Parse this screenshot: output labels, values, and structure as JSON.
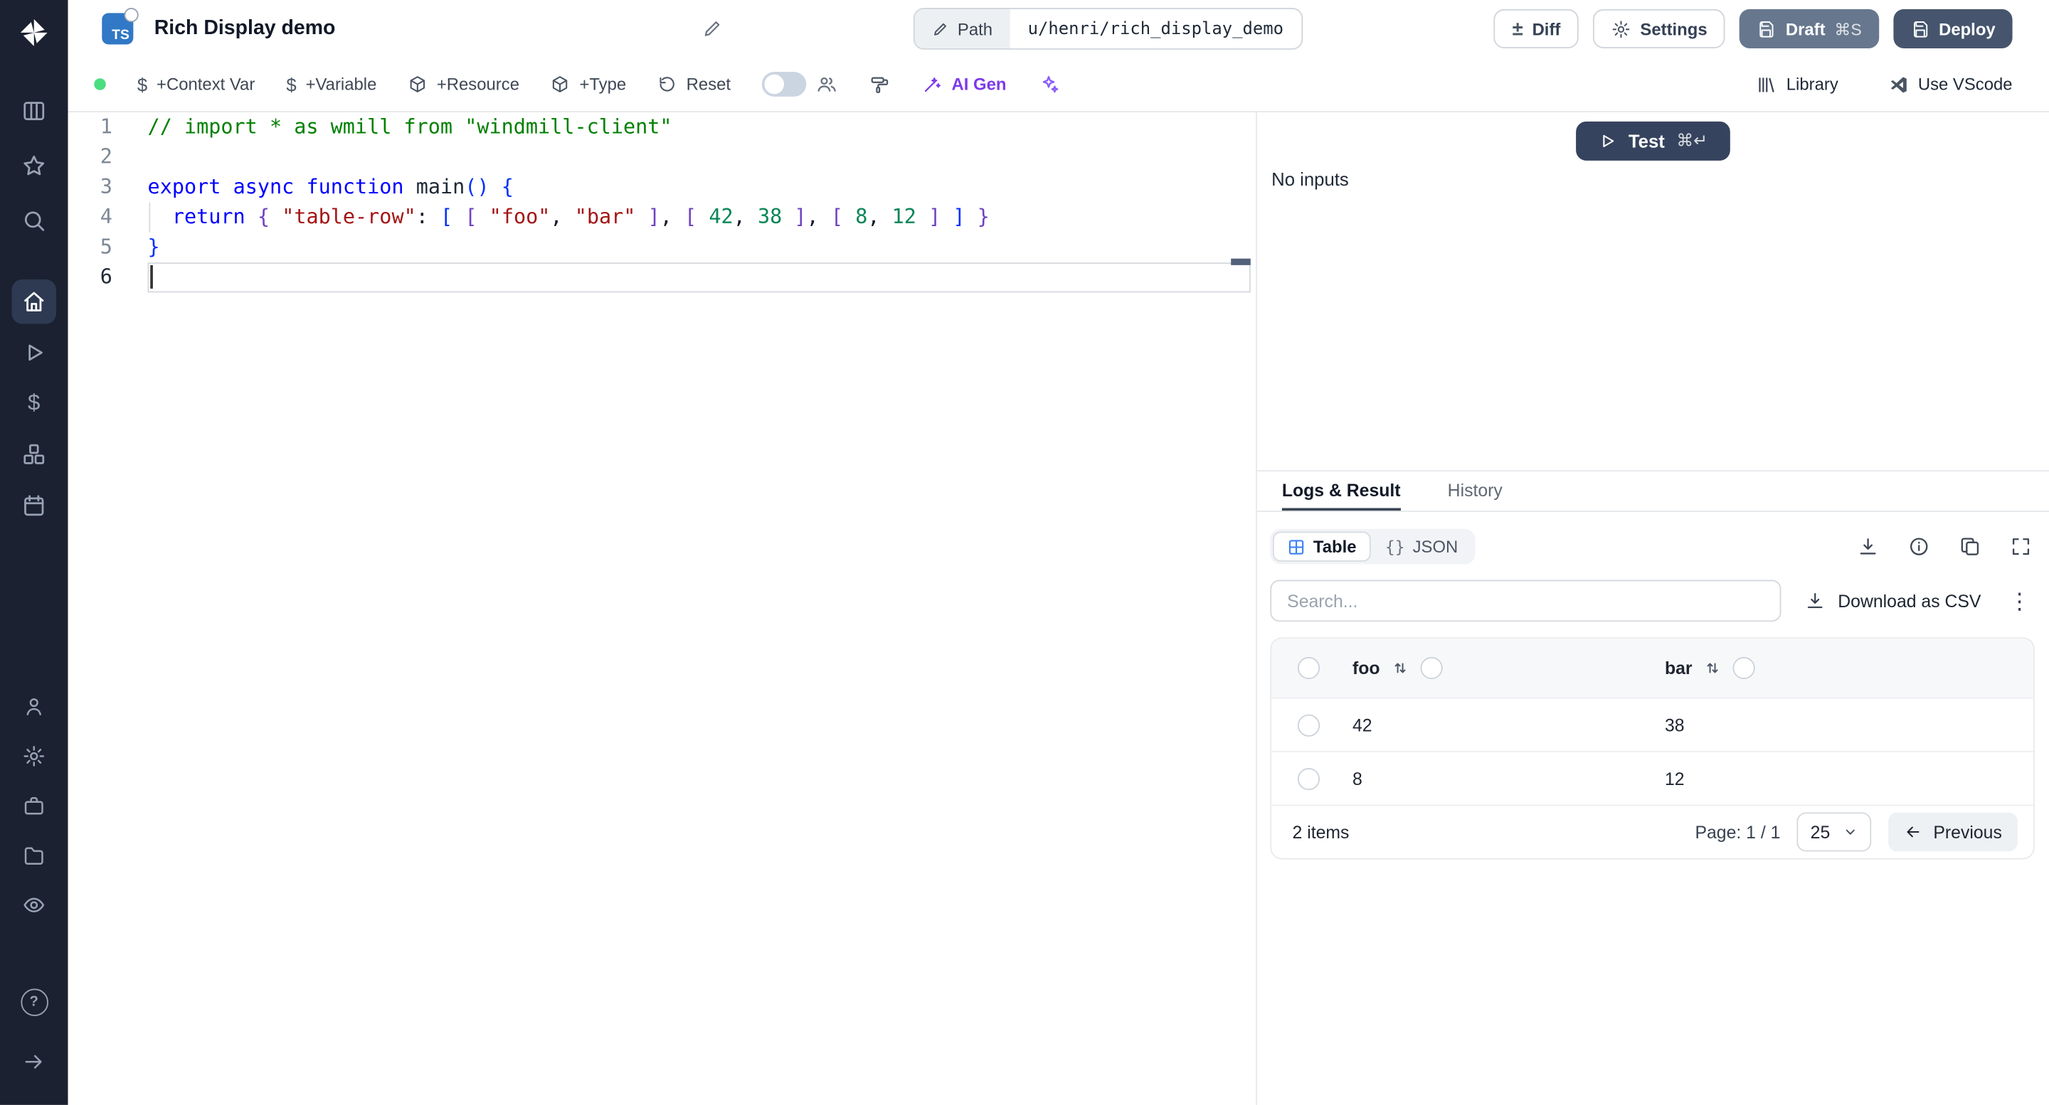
{
  "colors": {
    "accent_blue": "#3178c6",
    "violet": "#7c3aed",
    "green_dot": "#4ade80",
    "test_button": "#36435e",
    "deploy_button": "#46556d",
    "draft_button": "#67778e",
    "sidebar_bg": "#1b2130",
    "table_icon_blue": "#3b82f6"
  },
  "glyphs": {
    "dollar": "$",
    "help": "?",
    "kebab": "⋮",
    "braces": "{}",
    "plus_minus": "±"
  },
  "header": {
    "badge": "TS",
    "title": "Rich Display demo",
    "path": {
      "label": "Path",
      "value": "u/henri/rich_display_demo"
    },
    "buttons": {
      "diff": "Diff",
      "settings": "Settings",
      "draft": "Draft",
      "draft_shortcut": "⌘S",
      "deploy": "Deploy"
    }
  },
  "toolbar": {
    "context_var": "+Context Var",
    "variable": "+Variable",
    "resource": "+Resource",
    "type": "+Type",
    "reset": "Reset",
    "ai_gen": "AI Gen",
    "library": "Library",
    "use_vscode": "Use VScode"
  },
  "editor": {
    "lines": [
      {
        "num": "1",
        "tokens": [
          {
            "t": "// import * as wmill from \"windmill-client\"",
            "c": "com"
          }
        ]
      },
      {
        "num": "2",
        "tokens": []
      },
      {
        "num": "3",
        "tokens": [
          {
            "t": "export",
            "c": "kw"
          },
          {
            "t": " ",
            "c": "pl"
          },
          {
            "t": "async",
            "c": "kw"
          },
          {
            "t": " ",
            "c": "pl"
          },
          {
            "t": "function",
            "c": "kw"
          },
          {
            "t": " ",
            "c": "pl"
          },
          {
            "t": "main",
            "c": "fn"
          },
          {
            "t": "()",
            "c": "b1"
          },
          {
            "t": " ",
            "c": "pl"
          },
          {
            "t": "{",
            "c": "b1"
          }
        ]
      },
      {
        "num": "4",
        "tokens": [
          {
            "t": "  ",
            "c": "pl"
          },
          {
            "t": "return",
            "c": "kw"
          },
          {
            "t": " ",
            "c": "pl"
          },
          {
            "t": "{",
            "c": "b2"
          },
          {
            "t": " ",
            "c": "pl"
          },
          {
            "t": "\"table-row\"",
            "c": "str"
          },
          {
            "t": ": ",
            "c": "pl"
          },
          {
            "t": "[",
            "c": "b1"
          },
          {
            "t": " ",
            "c": "pl"
          },
          {
            "t": "[",
            "c": "b2"
          },
          {
            "t": " ",
            "c": "pl"
          },
          {
            "t": "\"foo\"",
            "c": "str"
          },
          {
            "t": ", ",
            "c": "pl"
          },
          {
            "t": "\"bar\"",
            "c": "str"
          },
          {
            "t": " ",
            "c": "pl"
          },
          {
            "t": "]",
            "c": "b2"
          },
          {
            "t": ", ",
            "c": "pl"
          },
          {
            "t": "[",
            "c": "b2"
          },
          {
            "t": " ",
            "c": "pl"
          },
          {
            "t": "42",
            "c": "num"
          },
          {
            "t": ", ",
            "c": "pl"
          },
          {
            "t": "38",
            "c": "num"
          },
          {
            "t": " ",
            "c": "pl"
          },
          {
            "t": "]",
            "c": "b2"
          },
          {
            "t": ", ",
            "c": "pl"
          },
          {
            "t": "[",
            "c": "b2"
          },
          {
            "t": " ",
            "c": "pl"
          },
          {
            "t": "8",
            "c": "num"
          },
          {
            "t": ", ",
            "c": "pl"
          },
          {
            "t": "12",
            "c": "num"
          },
          {
            "t": " ",
            "c": "pl"
          },
          {
            "t": "]",
            "c": "b2"
          },
          {
            "t": " ",
            "c": "pl"
          },
          {
            "t": "]",
            "c": "b1"
          },
          {
            "t": " ",
            "c": "pl"
          },
          {
            "t": "}",
            "c": "b2"
          }
        ]
      },
      {
        "num": "5",
        "tokens": [
          {
            "t": "}",
            "c": "b1"
          }
        ]
      },
      {
        "num": "6",
        "active": true,
        "tokens": []
      }
    ]
  },
  "run": {
    "test": "Test",
    "shortcut": "⌘↵",
    "no_inputs": "No inputs"
  },
  "result": {
    "tabs": {
      "logs": "Logs & Result",
      "history": "History"
    },
    "view": {
      "table": "Table",
      "json": "JSON",
      "json_icon": "{}"
    },
    "search_placeholder": "Search...",
    "download_csv": "Download as CSV",
    "table": {
      "columns": [
        "foo",
        "bar"
      ],
      "rows": [
        [
          "42",
          "38"
        ],
        [
          "8",
          "12"
        ]
      ],
      "summary": "2 items",
      "page": "Page: 1 / 1",
      "per_page": "25",
      "previous": "Previous"
    }
  }
}
